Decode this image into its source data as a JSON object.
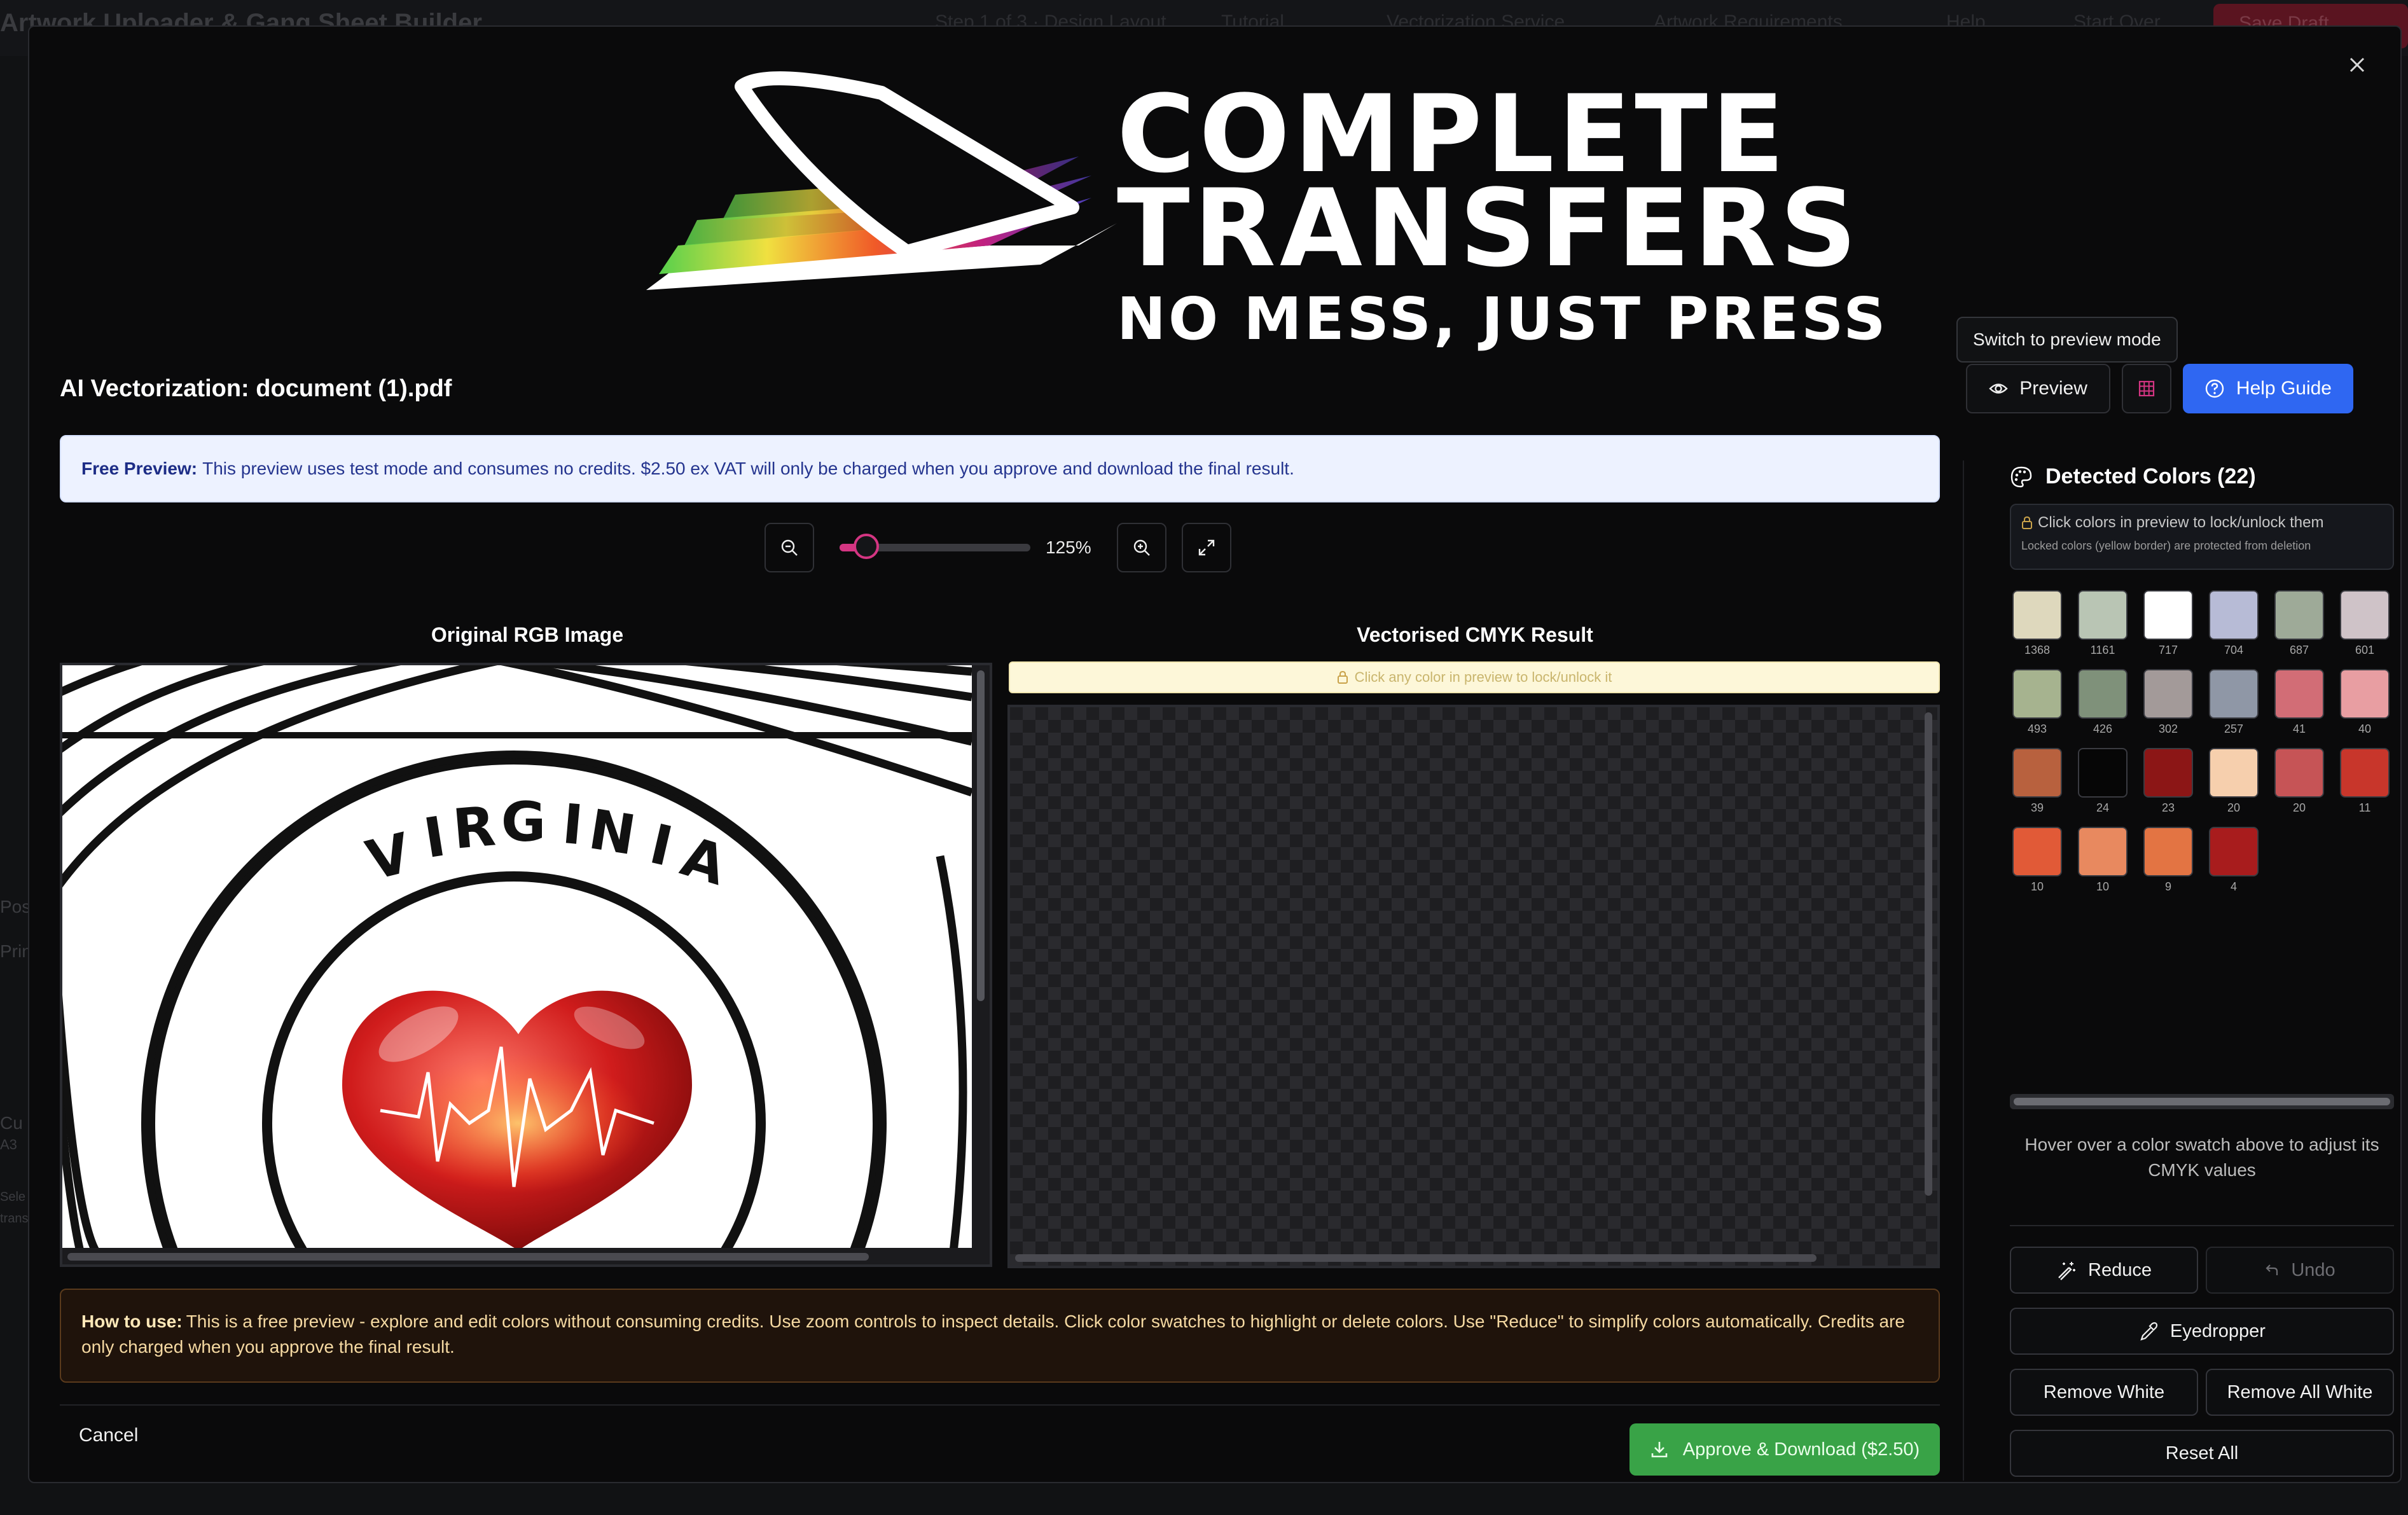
{
  "background_app": {
    "title": "Artwork Uploader & Gang Sheet Builder",
    "menu": [
      "Step 1 of 3 · Design Layout",
      "Tutorial",
      "Vectorization Service",
      "Artwork Requirements",
      "Help",
      "Start Over",
      "Save Draft"
    ],
    "left_fragments": [
      "Pos",
      "Prin",
      "Cu",
      "A3",
      "Sele",
      "trans"
    ]
  },
  "logo": {
    "line1": "COMPLETE",
    "line2": "TRANSFERS",
    "line3": "NO MESS, JUST PRESS"
  },
  "tooltip": "Switch to preview mode",
  "modal": {
    "title": "AI Vectorization: document (1).pdf",
    "preview_btn": "Preview",
    "help_btn": "Help Guide",
    "banner_bold": "Free Preview:",
    "banner_text": "This preview uses test mode and consumes no credits. $2.50 ex VAT will only be charged when you approve and download the final result.",
    "zoom": {
      "level": "125%",
      "slider_fraction": 0.14
    },
    "original_title": "Original RGB Image",
    "result_title": "Vectorised CMYK Result",
    "lock_hint": "Click any color in preview to lock/unlock it",
    "artwork_text": "VIRGINIA",
    "how_bold": "How to use:",
    "how_text": "This is a free preview - explore and edit colors without consuming credits. Use zoom controls to inspect details. Click color swatches to highlight or delete colors. Use \"Reduce\" to simplify colors automatically. Credits are only charged when you approve the final result.",
    "cancel": "Cancel",
    "approve": "Approve & Download ($2.50)"
  },
  "sidebar": {
    "title": "Detected Colors (22)",
    "note_line1": "Click colors in preview to lock/unlock them",
    "note_line2": "Locked colors (yellow border) are protected from deletion",
    "swatches": [
      {
        "color": "#ded8bd",
        "count": "1368"
      },
      {
        "color": "#b9c5b4",
        "count": "1161"
      },
      {
        "color": "#ffffff",
        "count": "717"
      },
      {
        "color": "#b7bbd6",
        "count": "704"
      },
      {
        "color": "#9eaa98",
        "count": "687"
      },
      {
        "color": "#cfc3c8",
        "count": "601"
      },
      {
        "color": "#a6b38f",
        "count": "493"
      },
      {
        "color": "#7f917a",
        "count": "426"
      },
      {
        "color": "#a39a99",
        "count": "302"
      },
      {
        "color": "#8f97a6",
        "count": "257"
      },
      {
        "color": "#d26d76",
        "count": "41"
      },
      {
        "color": "#e89ea2",
        "count": "40"
      },
      {
        "color": "#b8613e",
        "count": "39"
      },
      {
        "color": "#060606",
        "count": "24"
      },
      {
        "color": "#8c1616",
        "count": "23"
      },
      {
        "color": "#f6cfad",
        "count": "20"
      },
      {
        "color": "#c65456",
        "count": "20"
      },
      {
        "color": "#c8362b",
        "count": "11"
      },
      {
        "color": "#e15a37",
        "count": "10"
      },
      {
        "color": "#e8895f",
        "count": "10"
      },
      {
        "color": "#e37443",
        "count": "9"
      },
      {
        "color": "#a81c1d",
        "count": "4"
      }
    ],
    "hover_hint": "Hover over a color swatch above to adjust its CMYK values",
    "reduce": "Reduce",
    "undo": "Undo",
    "eyedropper": "Eyedropper",
    "remove_white": "Remove White",
    "remove_all_white": "Remove All White",
    "reset_all": "Reset All"
  },
  "colors": {
    "accent": "#2f67f2",
    "approve": "#39a347",
    "slider": "#d43582"
  },
  "icons": [
    "close-icon",
    "eye-icon",
    "grid-icon",
    "help-circle-icon",
    "zoom-out-icon",
    "zoom-in-icon",
    "fullscreen-icon",
    "lock-icon",
    "palette-icon",
    "download-icon",
    "wand-icon",
    "undo-icon",
    "eyedropper-icon"
  ]
}
